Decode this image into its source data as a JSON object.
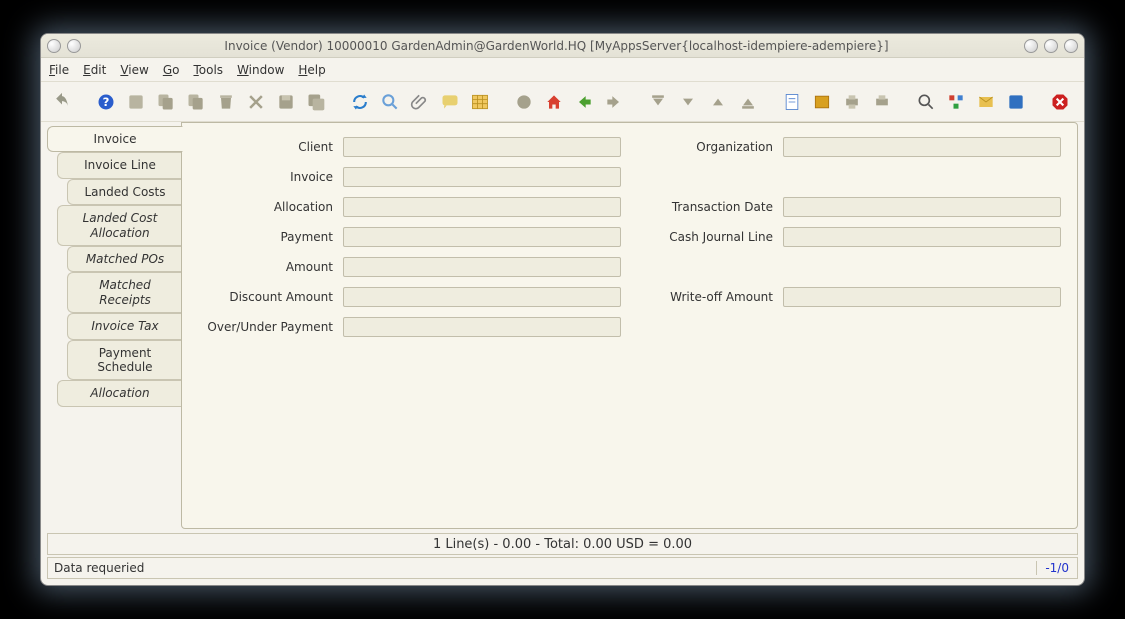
{
  "window": {
    "title": "Invoice (Vendor)  10000010  GardenAdmin@GardenWorld.HQ [MyAppsServer{localhost-idempiere-adempiere}]"
  },
  "menu": {
    "file": "File",
    "edit": "Edit",
    "view": "View",
    "go": "Go",
    "tools": "Tools",
    "window": "Window",
    "help": "Help"
  },
  "tabs": [
    {
      "label": "Invoice",
      "active": true,
      "indent": 0,
      "italic": false
    },
    {
      "label": "Invoice Line",
      "active": false,
      "indent": 1,
      "italic": false
    },
    {
      "label": "Landed Costs",
      "active": false,
      "indent": 2,
      "italic": false
    },
    {
      "label": "Landed Cost Allocation",
      "active": false,
      "indent": 1,
      "italic": true
    },
    {
      "label": "Matched POs",
      "active": false,
      "indent": 2,
      "italic": true
    },
    {
      "label": "Matched Receipts",
      "active": false,
      "indent": 2,
      "italic": true
    },
    {
      "label": "Invoice Tax",
      "active": false,
      "indent": 2,
      "italic": true
    },
    {
      "label": "Payment Schedule",
      "active": false,
      "indent": 2,
      "italic": false
    },
    {
      "label": "Allocation",
      "active": false,
      "indent": 1,
      "italic": true
    }
  ],
  "form": {
    "client_label": "Client",
    "organization_label": "Organization",
    "invoice_label": "Invoice",
    "allocation_label": "Allocation",
    "transaction_date_label": "Transaction Date",
    "payment_label": "Payment",
    "cash_journal_label": "Cash Journal Line",
    "amount_label": "Amount",
    "discount_amount_label": "Discount Amount",
    "writeoff_amount_label": "Write-off Amount",
    "overunder_label": "Over/Under Payment",
    "values": {
      "client": "",
      "organization": "",
      "invoice": "",
      "allocation": "",
      "transaction_date": "",
      "payment": "",
      "cash_journal": "",
      "amount": "",
      "discount_amount": "",
      "writeoff_amount": "",
      "overunder": ""
    }
  },
  "totals": "1 Line(s) - 0.00 -  Total: 0.00  USD  =  0.00",
  "status": {
    "message": "Data requeried",
    "count": "-1/0"
  },
  "toolbar_icons": [
    "undo",
    "help",
    "new",
    "copy",
    "copy2",
    "delete",
    "wrench",
    "save",
    "save2",
    "sep",
    "refresh",
    "lookup",
    "attachment",
    "chat",
    "grid",
    "sep",
    "globe",
    "home",
    "back",
    "forward",
    "sep",
    "first",
    "up",
    "down",
    "last",
    "sep",
    "report",
    "archive",
    "print",
    "print2",
    "sep",
    "zoom",
    "workflow",
    "process",
    "product",
    "sep",
    "stop"
  ]
}
